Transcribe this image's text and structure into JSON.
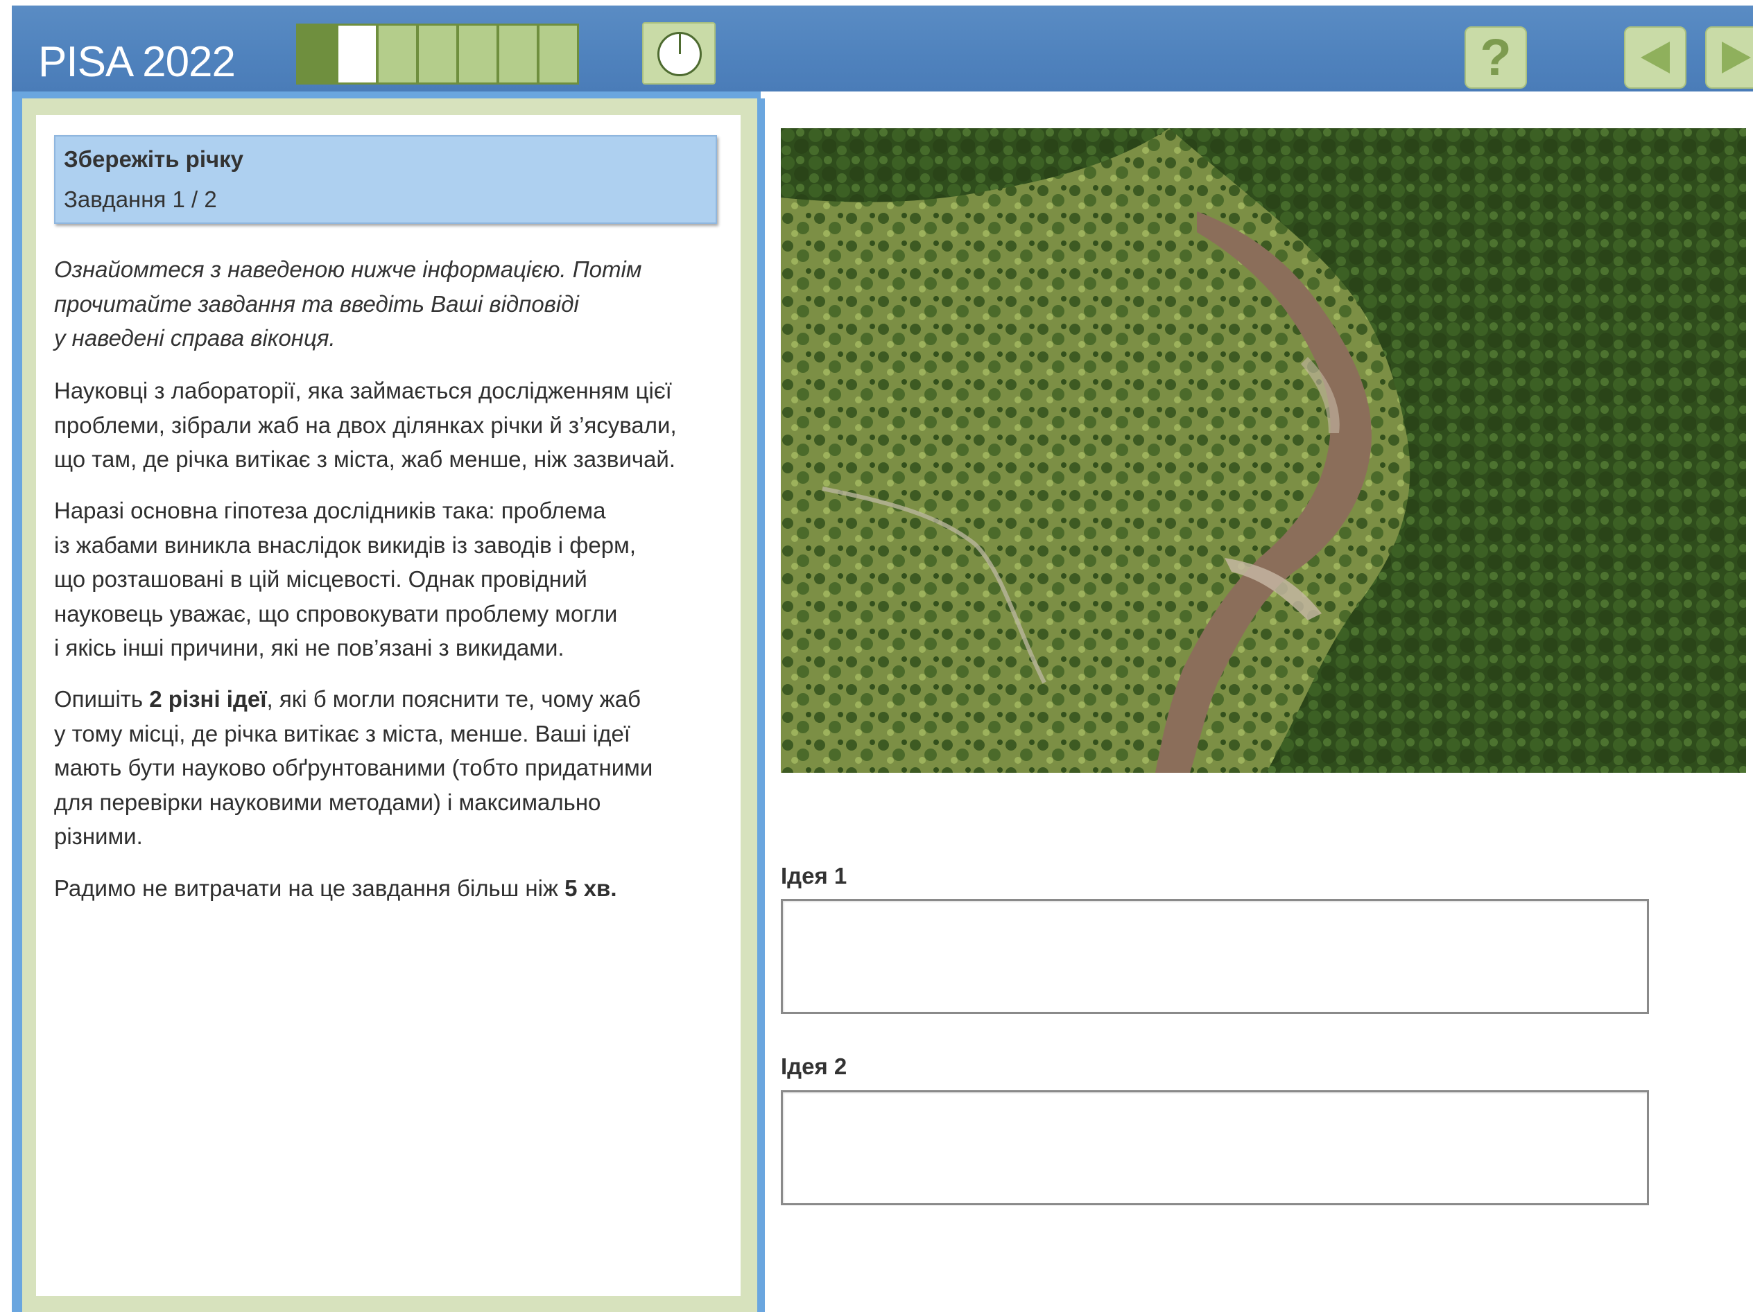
{
  "header": {
    "brand": "PISA 2022",
    "progress": {
      "total": 7,
      "done": 1,
      "current": 2
    },
    "help_symbol": "?",
    "icons": [
      "clock-icon",
      "help-icon",
      "arrow-left-icon",
      "arrow-right-icon"
    ]
  },
  "task": {
    "title": "Збережіть річку",
    "subtitle": "Завдання 1 / 2",
    "intro_lines": [
      "Ознайомтеся з наведеною нижче інформацією. Потім",
      "прочитайте завдання та введіть Ваші відповіді",
      "у наведені справа віконця."
    ],
    "paragraph1_lines": [
      "Науковці з лабораторії, яка займається дослідженням цієї",
      "проблеми, зібрали жаб на двох ділянках річки й з’ясували,",
      "що там, де річка витікає з міста, жаб менше, ніж зазвичай."
    ],
    "paragraph2_lines": [
      "Наразі основна гіпотеза дослідників така: проблема",
      "із жабами виникла внаслідок викидів із заводів і ферм,",
      "що розташовані в цій місцевості. Однак провідний",
      "науковець уважає, що спровокувати проблему могли",
      "і якісь інші причини, які не пов’язані з викидами."
    ],
    "paragraph3": {
      "line1_a": "Опишіть ",
      "line1_b": "2 різні ідеї",
      "line1_c": ", які б могли пояснити те, чому жаб",
      "lines_rest": [
        "у тому місці, де річка витікає з міста, менше. Ваші ідеї",
        "мають бути науково обґрунтованими (тобто придатними",
        "для перевірки науковими методами) і максимально",
        "різними."
      ]
    },
    "paragraph4": {
      "text_a": "Радимо не витрачати на це завдання більш ніж ",
      "text_b": "5 хв."
    }
  },
  "answers": {
    "idea1_label": "Ідея 1",
    "idea1_value": "",
    "idea2_label": "Ідея 2",
    "idea2_value": ""
  },
  "colors": {
    "header_blue": "#4f82bd",
    "accent_green": "#6f8f3e",
    "light_green": "#c9dba7",
    "task_header_blue": "#aed0f0"
  }
}
